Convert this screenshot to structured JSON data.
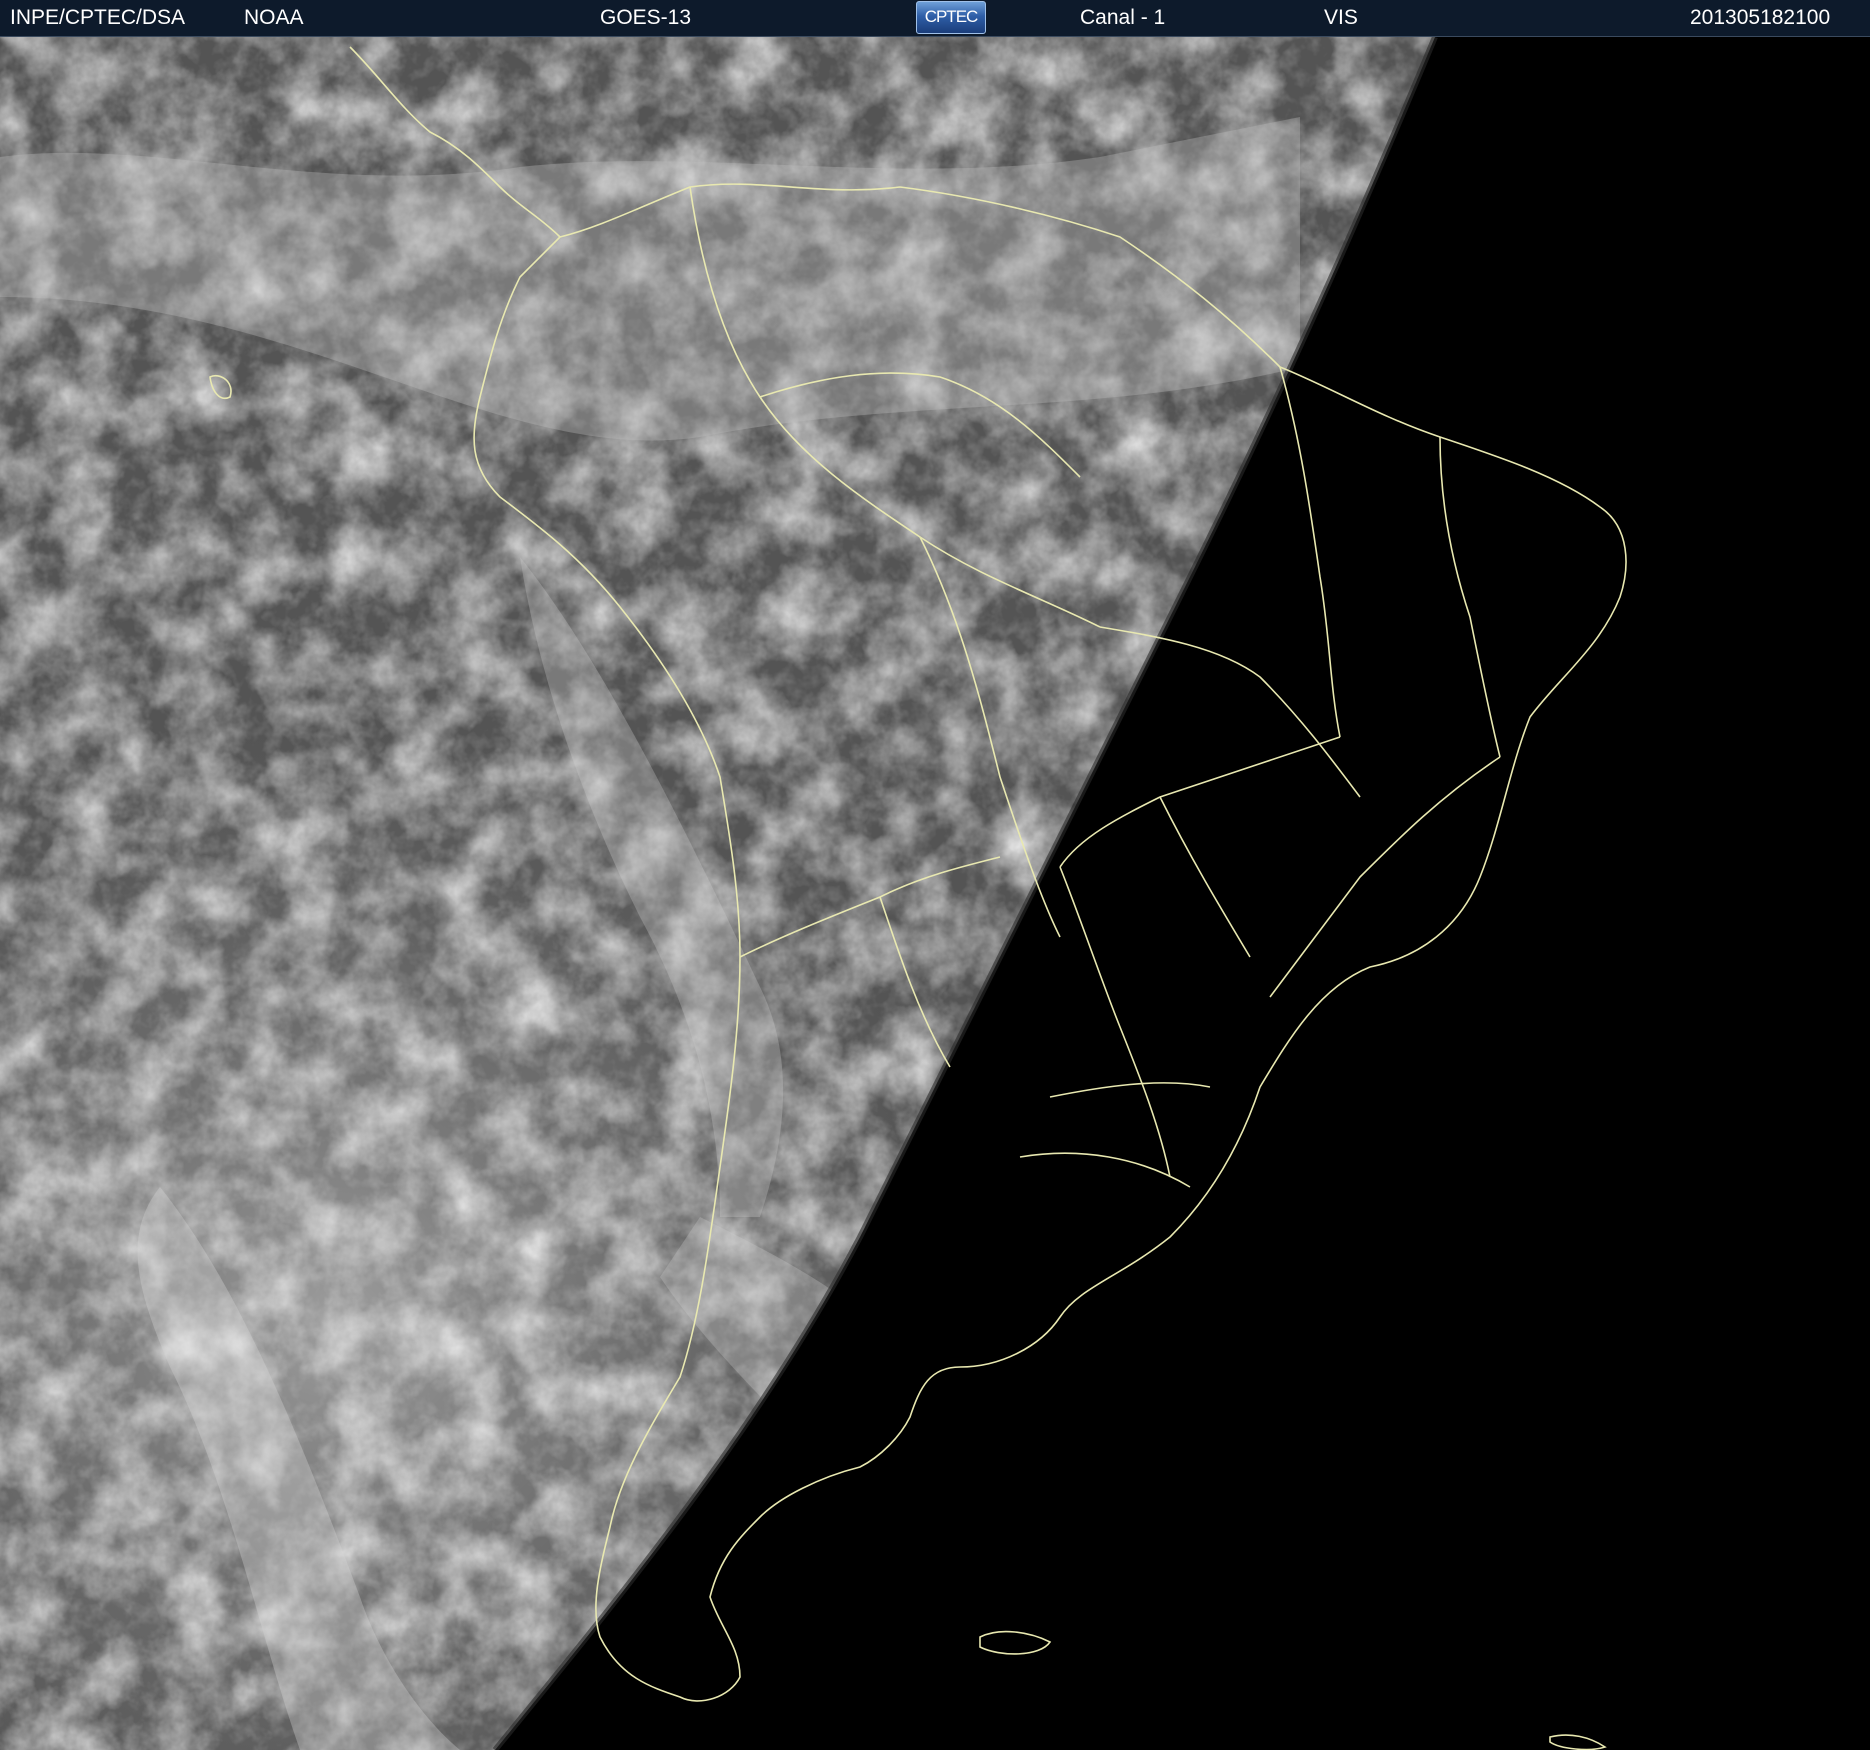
{
  "header": {
    "institution": "INPE/CPTEC/DSA",
    "agency": "NOAA",
    "satellite": "GOES-13",
    "logo_text": "CPTEC",
    "channel": "Canal - 1",
    "band": "VIS",
    "timestamp": "201305182100"
  },
  "colors": {
    "header_bg": "#0d1a2b",
    "header_text": "#ffffff",
    "boundary_lines": "#e8e8b0",
    "night_side": "#000000"
  },
  "image": {
    "type": "satellite-visible-channel",
    "region": "South America",
    "icons": [
      "cptec-logo"
    ]
  }
}
